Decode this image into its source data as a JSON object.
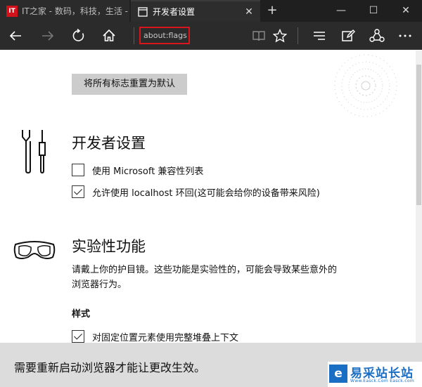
{
  "tabs": [
    {
      "title": "IT之家 - 数码，科技，生活 -",
      "favicon": "IT",
      "active": false
    },
    {
      "title": "开发者设置",
      "active": true
    }
  ],
  "window": {
    "new_tab": "+",
    "minimize": "—",
    "maximize": "☐",
    "close": "✕"
  },
  "toolbar": {
    "address": "about:flags"
  },
  "content": {
    "reset_button": "将所有标志重置为默认",
    "developer": {
      "title": "开发者设置",
      "options": [
        {
          "label": "使用 Microsoft 兼容性列表",
          "checked": false
        },
        {
          "label": "允许使用 localhost 环回(这可能会给你的设备带来风险)",
          "checked": true
        }
      ]
    },
    "experimental": {
      "title": "实验性功能",
      "description": "请戴上你的护目镜。这些功能是实验性的，可能会导致某些意外的浏览器行为。",
      "subhead": "样式",
      "options": [
        {
          "label": "对固定位置元素使用完整堆叠上下文",
          "checked": true
        }
      ]
    }
  },
  "notice": {
    "text": "需要重新启动浏览器才能让更改生效。"
  },
  "watermark": {
    "logo": "e",
    "text": "易采站长站",
    "sub": "Www.Easck.Com  Easck.com"
  },
  "colors": {
    "chrome": "#2b2b2b",
    "address_highlight": "#d8141c",
    "notice_bg": "#dcdcdc",
    "watermark": "#1a6fc4"
  }
}
